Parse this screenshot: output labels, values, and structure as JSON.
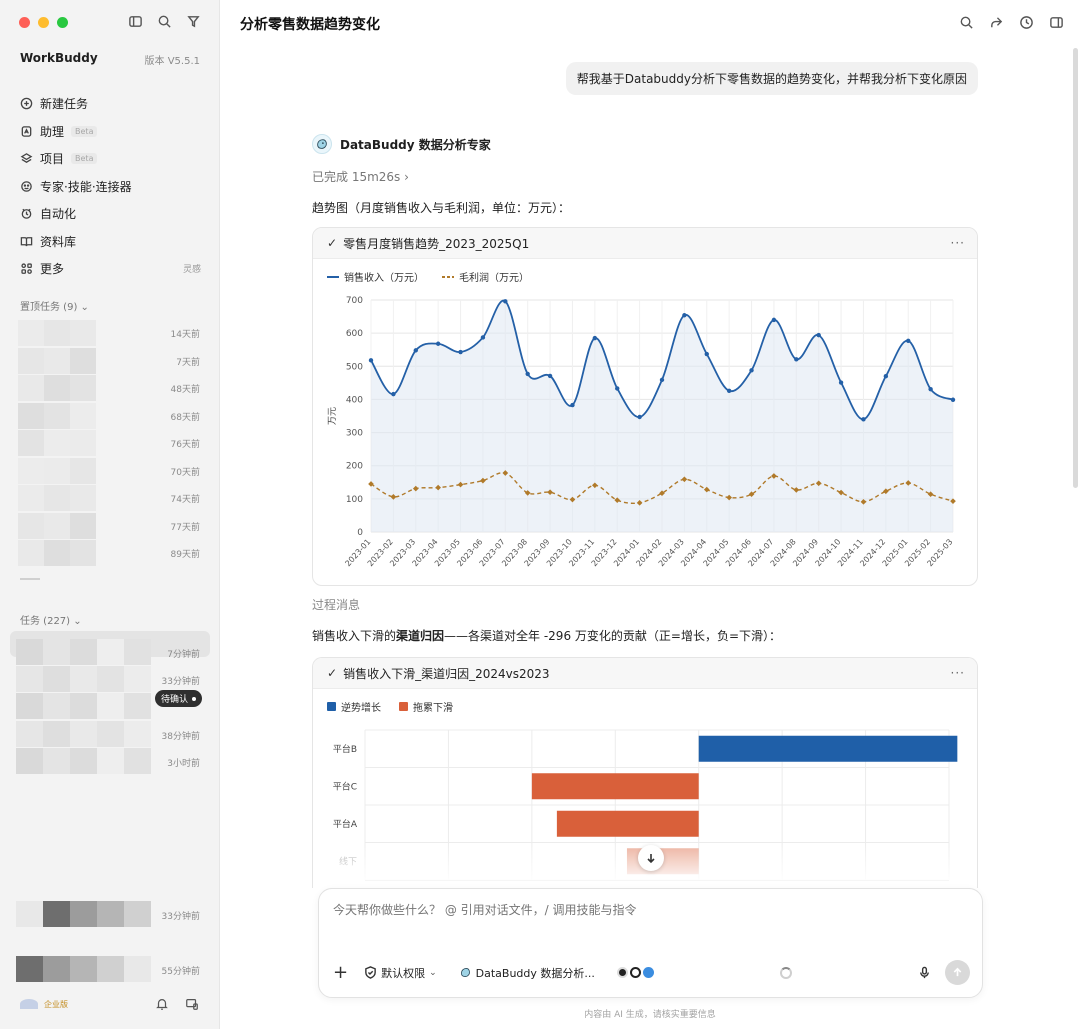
{
  "sidebar": {
    "brand": "WorkBuddy",
    "version": "版本 V5.5.1",
    "nav": [
      {
        "label": "新建任务",
        "icon": "plus-circle-icon",
        "beta": "",
        "right": ""
      },
      {
        "label": "助理",
        "icon": "assistant-icon",
        "beta": "Beta",
        "right": ""
      },
      {
        "label": "项目",
        "icon": "project-icon",
        "beta": "Beta",
        "right": ""
      },
      {
        "label": "专家·技能·连接器",
        "icon": "expert-icon",
        "beta": "",
        "right": ""
      },
      {
        "label": "自动化",
        "icon": "automation-icon",
        "beta": "",
        "right": ""
      },
      {
        "label": "资料库",
        "icon": "library-icon",
        "beta": "",
        "right": ""
      },
      {
        "label": "更多",
        "icon": "more-grid-icon",
        "beta": "",
        "right": "灵感"
      }
    ],
    "pinned_title": "置顶任务 (9)",
    "pinned_times": [
      "14天前",
      "7天前",
      "48天前",
      "68天前",
      "76天前",
      "70天前",
      "74天前",
      "77天前",
      "89天前"
    ],
    "tasks_title": "任务 (227)",
    "task_times": [
      "7分钟前",
      "33分钟前",
      "",
      "38分钟前",
      "3小时前",
      "33分钟前",
      "55分钟前"
    ],
    "confirm_badge": "待确认",
    "edition": "企业版"
  },
  "header": {
    "title": "分析零售数据趋势变化"
  },
  "chat": {
    "user_message": "帮我基于Databuddy分析下零售数据的趋势变化，并帮我分析下变化原因",
    "agent_name": "DataBuddy 数据分析专家",
    "completed": "已完成 15m26s",
    "intro_trend": "趋势图（月度销售收入与毛利润，单位：万元）：",
    "card1_title": "零售月度销售趋势_2023_2025Q1",
    "process_label": "过程消息",
    "intro_channel_pre": "销售收入下滑的",
    "intro_channel_bold": "渠道归因",
    "intro_channel_post": "——各渠道对全年 -296 万变化的贡献（正=增长，负=下滑）：",
    "card2_title": "销售收入下滑_渠道归因_2024vs2023"
  },
  "input": {
    "placeholder": "今天帮你做些什么？ @ 引用对话文件，/ 调用技能与指令",
    "permission": "默认权限",
    "agent_chip": "DataBuddy 数据分析..."
  },
  "footer": {
    "disclaimer": "内容由 AI 生成，请核实重要信息"
  },
  "colors": {
    "revenue": "#2460a7",
    "profit": "#b07a2a",
    "growth": "#1f5fa8",
    "drag": "#d9603a"
  },
  "chart_data": [
    {
      "type": "line",
      "ylabel": "万元",
      "ylim": [
        0,
        700
      ],
      "yticks": [
        0,
        100,
        200,
        300,
        400,
        500,
        600,
        700
      ],
      "grid": true,
      "legend": "top-left",
      "x": [
        "2023-01",
        "2023-02",
        "2023-03",
        "2023-04",
        "2023-05",
        "2023-06",
        "2023-07",
        "2023-08",
        "2023-09",
        "2023-10",
        "2023-11",
        "2023-12",
        "2024-01",
        "2024-02",
        "2024-03",
        "2024-04",
        "2024-05",
        "2024-06",
        "2024-07",
        "2024-08",
        "2024-09",
        "2024-10",
        "2024-11",
        "2024-12",
        "2025-01",
        "2025-02",
        "2025-03"
      ],
      "series": [
        {
          "name": "销售收入（万元）",
          "values": [
            518,
            416,
            548,
            568,
            543,
            587,
            696,
            477,
            471,
            383,
            585,
            433,
            347,
            459,
            654,
            537,
            426,
            488,
            640,
            521,
            594,
            451,
            340,
            470,
            577,
            431,
            399
          ]
        },
        {
          "name": "毛利润（万元）",
          "values": [
            145,
            106,
            131,
            134,
            143,
            155,
            178,
            118,
            120,
            98,
            141,
            96,
            88,
            117,
            159,
            128,
            104,
            114,
            169,
            127,
            147,
            119,
            91,
            123,
            148,
            114,
            93
          ]
        }
      ]
    },
    {
      "type": "bar",
      "orientation": "horizontal",
      "categories": [
        "平台B",
        "平台C",
        "平台A",
        "线下"
      ],
      "values": [
        155,
        -100,
        -85,
        -43
      ],
      "legend_items": [
        "逆势增长",
        "拖累下滑"
      ],
      "grid": true,
      "legend": "top-left"
    }
  ]
}
